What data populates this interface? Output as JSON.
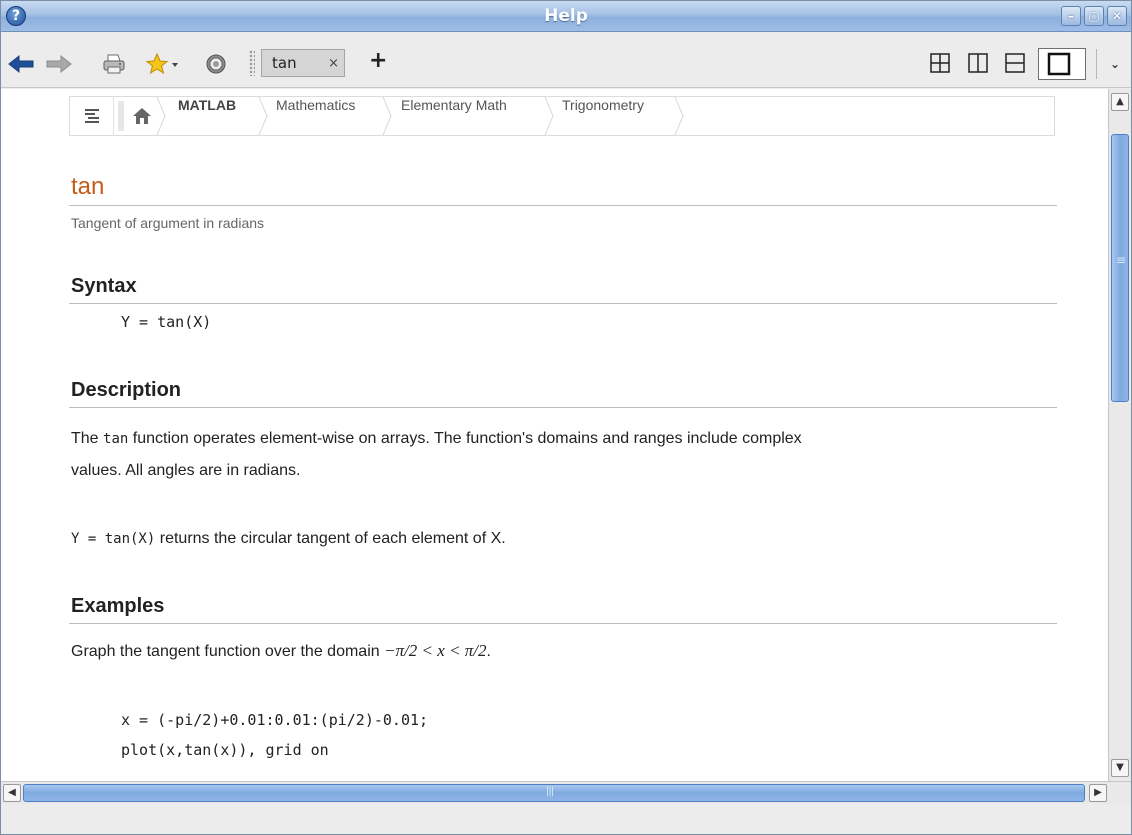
{
  "window": {
    "title": "Help",
    "controls": {
      "minimize": "–",
      "maximize": "▢",
      "close": "✕"
    }
  },
  "toolbar": {
    "tab_label": "tan",
    "tab_close": "×",
    "add_tab": "+",
    "overflow": "⌄"
  },
  "breadcrumb": {
    "items": [
      "MATLAB",
      "Mathematics",
      "Elementary Math",
      "Trigonometry"
    ]
  },
  "doc": {
    "title": "tan",
    "purpose": "Tangent of argument in radians",
    "syntax_heading": "Syntax",
    "syntax_code": "Y = tan(X)",
    "description_heading": "Description",
    "desc_p1_pre": "The ",
    "desc_p1_code": "tan",
    "desc_p1_post": " function operates element-wise on arrays. The function's domains and ranges include complex",
    "desc_p1_line2": "values. All angles are in radians.",
    "desc_p2_code": "Y = tan(X)",
    "desc_p2_text": " returns the circular tangent of each element of X.",
    "examples_heading": "Examples",
    "example_text": "Graph the tangent function over the domain ",
    "example_math": "−π/2 < x < π/2",
    "example_period": ".",
    "code_line1": "x = (-pi/2)+0.01:0.01:(pi/2)-0.01;",
    "code_line2": "plot(x,tan(x)), grid on"
  },
  "colors": {
    "title_accent": "#c45c18",
    "titlebar": "#9dbde6",
    "scroll_thumb": "#7eaae0"
  },
  "icons": [
    "help-app-icon",
    "back-arrow-icon",
    "forward-arrow-icon",
    "print-icon",
    "favorites-star-icon",
    "settings-gear-icon",
    "table-of-contents-icon",
    "home-icon",
    "layout-grid-icon",
    "layout-columns-icon",
    "layout-rows-icon",
    "layout-single-icon"
  ]
}
